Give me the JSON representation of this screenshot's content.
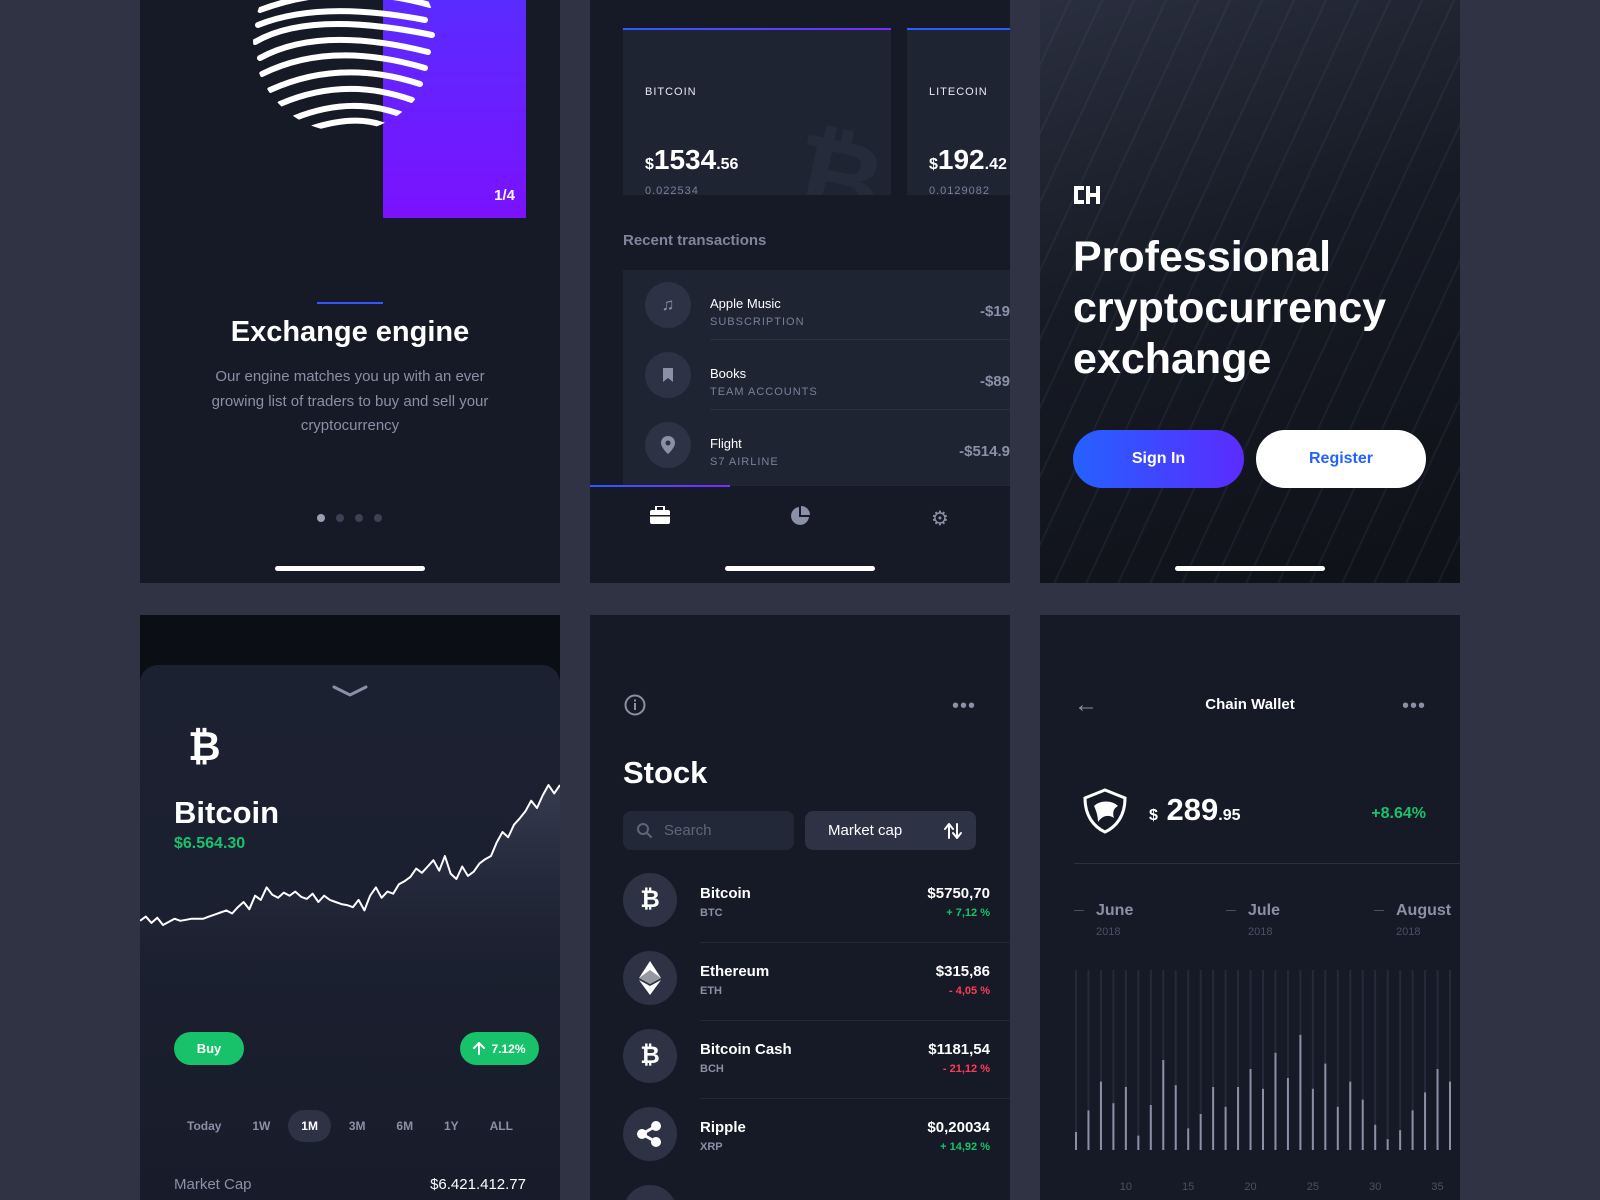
{
  "onboarding": {
    "page_indicator": "1/4",
    "title": "Exchange engine",
    "description": "Our engine matches you up with an ever growing list of traders to buy and sell your cryptocurrency",
    "dots": [
      true,
      false,
      false,
      false
    ]
  },
  "portfolio": {
    "investments": [
      {
        "label": "BITCOIN",
        "currency": "$",
        "whole": "1534",
        "cents": ".56",
        "amount_crypto": "0.022534"
      },
      {
        "label": "LITECOIN",
        "currency": "$",
        "whole": "192",
        "cents": ".42",
        "amount_crypto": "0.0129082"
      }
    ],
    "recent_title": "Recent transactions",
    "transactions": [
      {
        "name": "Apple Music",
        "category": "SUBSCRIPTION",
        "amount": "-$19",
        "icon": "music-icon"
      },
      {
        "name": "Books",
        "category": "TEAM ACCOUNTS",
        "amount": "-$89",
        "icon": "bookmark-icon"
      },
      {
        "name": "Flight",
        "category": "S7 AIRLINE",
        "amount": "-$514.9",
        "icon": "location-pin-icon"
      }
    ],
    "tabs": [
      {
        "icon": "briefcase-icon",
        "active": true
      },
      {
        "icon": "pie-chart-icon",
        "active": false
      },
      {
        "icon": "gear-icon",
        "active": false
      }
    ]
  },
  "landing": {
    "headline": "Professional cryptocurrency exchange",
    "signin_label": "Sign In",
    "register_label": "Register",
    "accent": "#2561ff"
  },
  "coin_detail": {
    "name": "Bitcoin",
    "price": "$6.564.30",
    "buy_label": "Buy",
    "change": "7.12%",
    "ranges": [
      "Today",
      "1W",
      "1M",
      "3M",
      "6M",
      "1Y",
      "ALL"
    ],
    "active_range": "1M",
    "market_cap_label": "Market Cap",
    "market_cap_value": "$6.421.412.77",
    "chart_data": {
      "type": "line",
      "values": [
        20,
        24,
        18,
        23,
        16,
        19,
        22,
        20,
        21,
        22,
        22,
        22,
        24,
        26,
        28,
        30,
        27,
        33,
        38,
        31,
        44,
        40,
        52,
        45,
        42,
        47,
        44,
        48,
        43,
        41,
        46,
        38,
        44,
        40,
        38,
        36,
        35,
        33,
        40,
        30,
        44,
        52,
        42,
        48,
        46,
        55,
        58,
        62,
        70,
        66,
        72,
        78,
        68,
        82,
        65,
        60,
        72,
        63,
        67,
        75,
        79,
        82,
        95,
        105,
        100,
        112,
        118,
        125,
        135,
        128,
        140,
        150,
        142,
        150
      ]
    }
  },
  "stock": {
    "title": "Stock",
    "search_placeholder": "Search",
    "sort_label": "Market cap",
    "coins": [
      {
        "name": "Bitcoin",
        "symbol": "BTC",
        "price": "$5750,70",
        "change": "+ 7,12 %",
        "direction": "up",
        "icon": "bitcoin-icon"
      },
      {
        "name": "Ethereum",
        "symbol": "ETH",
        "price": "$315,86",
        "change": "- 4,05 %",
        "direction": "down",
        "icon": "ethereum-icon"
      },
      {
        "name": "Bitcoin Cash",
        "symbol": "BCH",
        "price": "$1181,54",
        "change": "- 21,12 %",
        "direction": "down",
        "icon": "bitcoin-icon"
      },
      {
        "name": "Ripple",
        "symbol": "XRP",
        "price": "$0,20034",
        "change": "+ 14,92 %",
        "direction": "up",
        "icon": "ripple-icon"
      }
    ]
  },
  "wallet": {
    "title": "Chain Wallet",
    "currency": "$",
    "whole": "289",
    "cents": ".95",
    "change": "+8.64%",
    "months": [
      {
        "name": "June",
        "year": "2018"
      },
      {
        "name": "Jule",
        "year": "2018"
      },
      {
        "name": "August",
        "year": "2018"
      }
    ],
    "axis_ticks": [
      "10",
      "15",
      "20",
      "25",
      "30",
      "35"
    ],
    "chart_data": {
      "type": "bar",
      "x": [
        6,
        7,
        8,
        9,
        10,
        11,
        12,
        13,
        14,
        15,
        16,
        17,
        18,
        19,
        20,
        21,
        22,
        23,
        24,
        25,
        26,
        27,
        28,
        29,
        30,
        31,
        32,
        33,
        34,
        35,
        36
      ],
      "values": [
        10,
        22,
        38,
        26,
        35,
        8,
        25,
        50,
        36,
        12,
        20,
        35,
        24,
        35,
        45,
        34,
        54,
        40,
        64,
        34,
        48,
        24,
        38,
        28,
        14,
        6,
        11,
        22,
        32,
        45,
        38
      ]
    }
  }
}
